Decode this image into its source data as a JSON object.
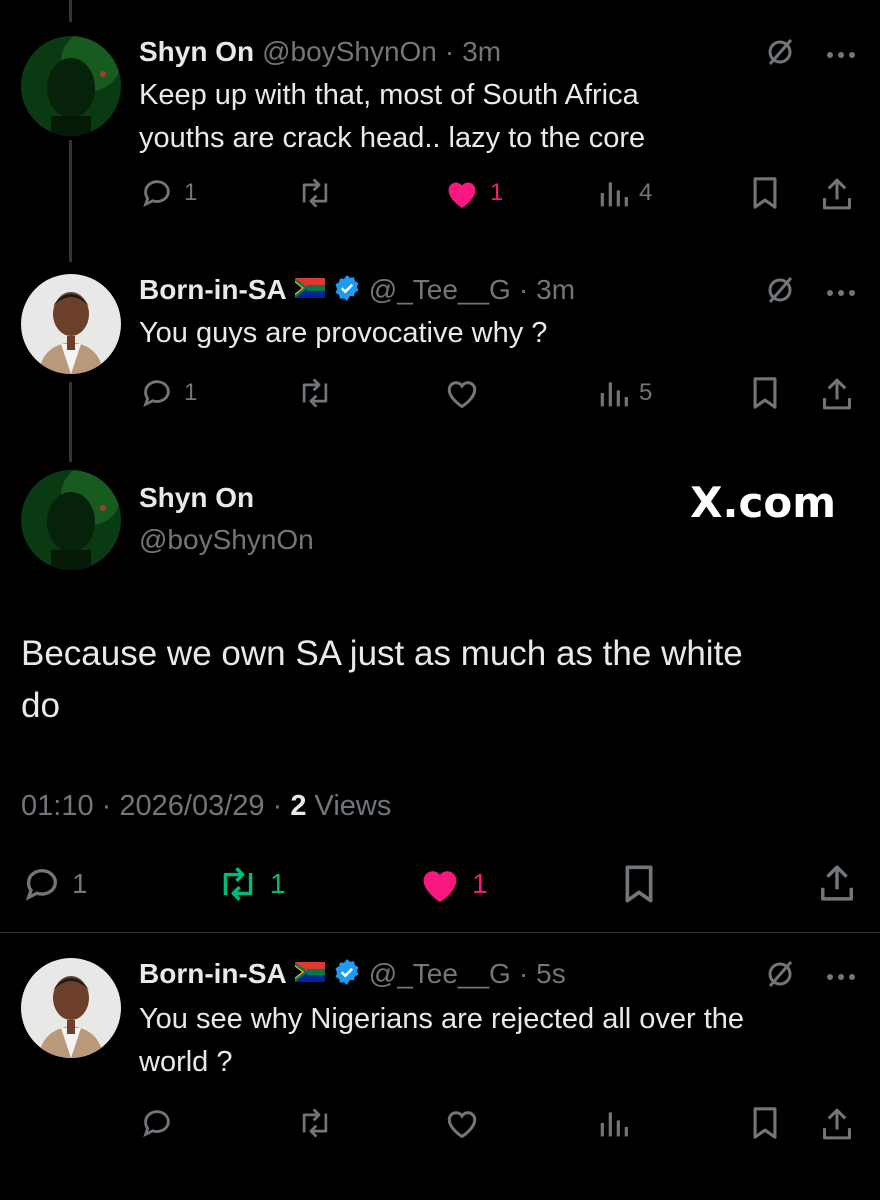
{
  "tweets": [
    {
      "name": "Shyn On",
      "handle": "@boyShynOn",
      "sep": "·",
      "time": "3m",
      "text_line1": "Keep up with that,  most of South Africa",
      "text_line2": "youths are crack head.. lazy to the core",
      "replies": "1",
      "reposts": "",
      "likes": "1",
      "views": "4",
      "liked": true
    },
    {
      "name": "Born-in-SA",
      "handle": "@_Tee__G",
      "sep": "·",
      "time": "3m",
      "text_line1": "You guys are provocative why ?",
      "replies": "1",
      "reposts": "",
      "likes": "",
      "views": "5",
      "verified": true
    }
  ],
  "main_tweet": {
    "name": "Shyn On",
    "handle": "@boyShynOn",
    "watermark": "X.com",
    "text_line1": "Because we own SA just as much as the white",
    "text_line2": "do",
    "time": "01:10",
    "sep1": "·",
    "date": "2026/03/29",
    "sep2": "·",
    "views_count": "2",
    "views_label": "Views",
    "replies": "1",
    "reposts": "1",
    "likes": "1"
  },
  "reply": {
    "name": "Born-in-SA",
    "handle": "@_Tee__G",
    "sep": "·",
    "time": "5s",
    "text_line1": "You see why  Nigerians are rejected all over the",
    "text_line2": "world ?",
    "verified": true
  },
  "colors": {
    "background": "#000000",
    "text": "#e7e9ea",
    "muted": "#71767b",
    "like": "#f91880",
    "repost": "#00ba7c",
    "verified": "#1d9bf0"
  },
  "icons": [
    "reply-icon",
    "repost-icon",
    "heart-icon",
    "views-icon",
    "bookmark-icon",
    "share-icon",
    "grok-icon",
    "more-icon",
    "verified-icon",
    "sa-flag-icon"
  ]
}
